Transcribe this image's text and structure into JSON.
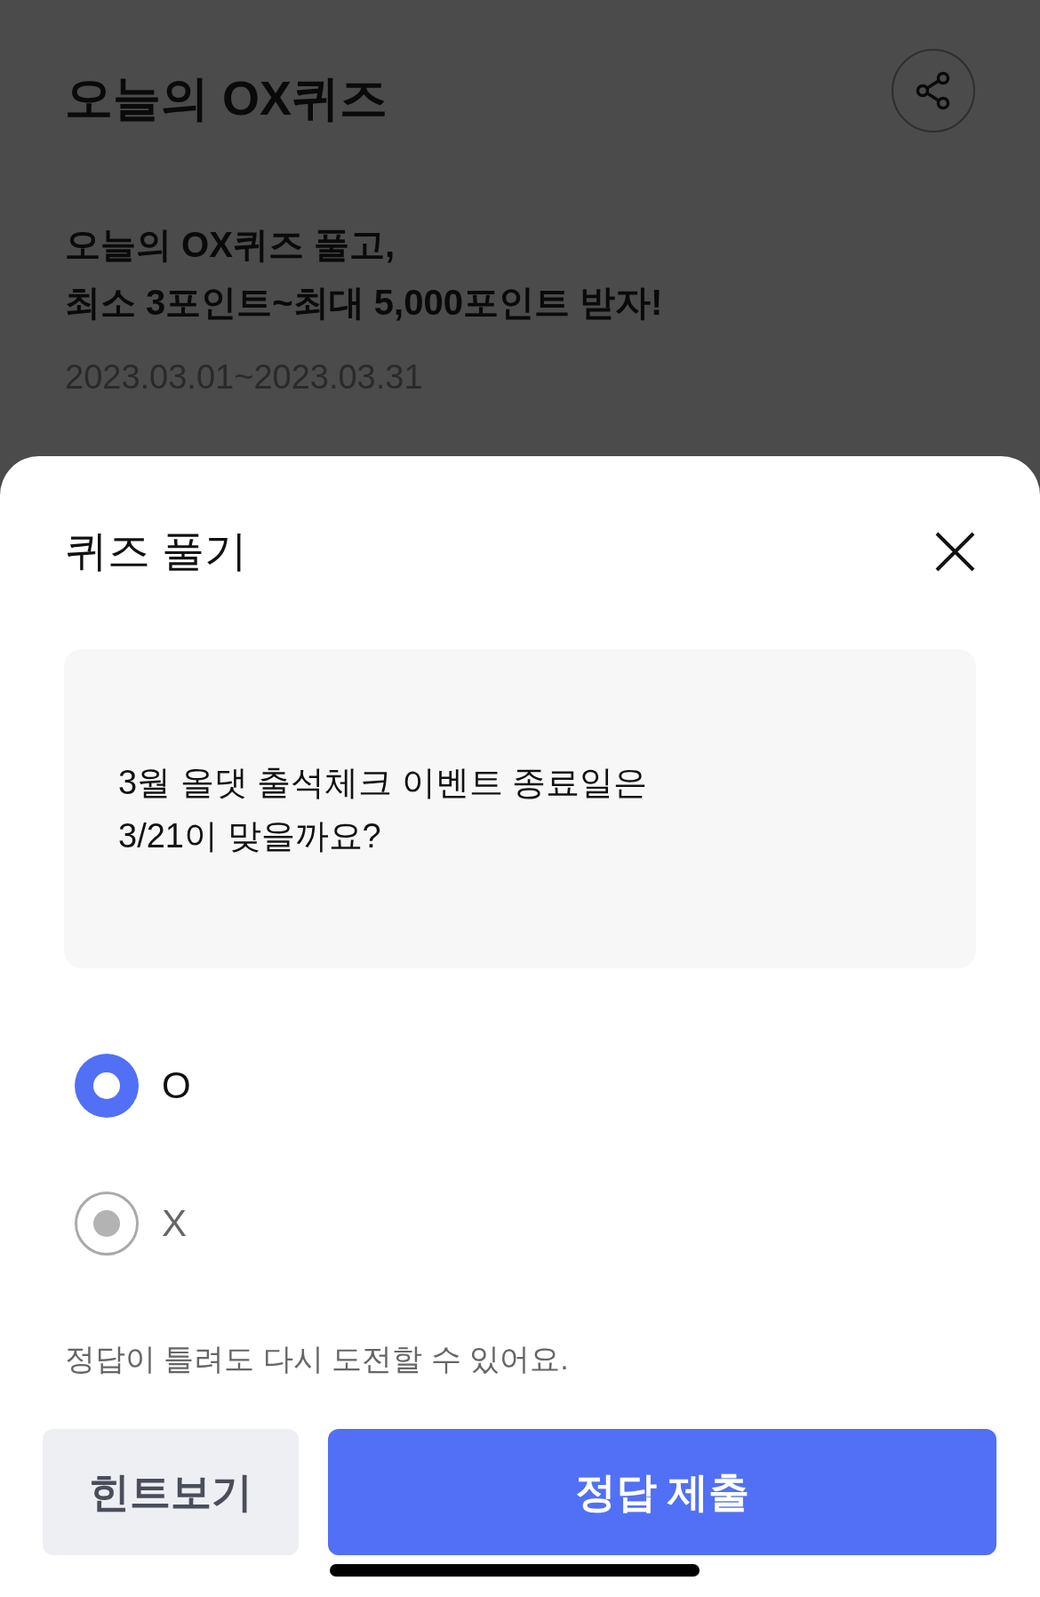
{
  "page": {
    "title": "오늘의 OX퀴즈",
    "headline": "오늘의 OX퀴즈 풀고,\n최소 3포인트~최대 5,000포인트 받자!",
    "period": "2023.03.01~2023.03.31"
  },
  "quiz_sheet": {
    "title": "퀴즈 풀기",
    "question": "3월 올댓 출석체크 이벤트 종료일은\n3/21이 맞을까요?",
    "options": [
      {
        "label": "O",
        "selected": true
      },
      {
        "label": "X",
        "selected": false
      }
    ],
    "note": "정답이 틀려도 다시 도전할 수 있어요.",
    "buttons": [
      {
        "label": "힌트보기",
        "kind": "secondary"
      },
      {
        "label": "정답 제출",
        "kind": "primary"
      }
    ]
  }
}
